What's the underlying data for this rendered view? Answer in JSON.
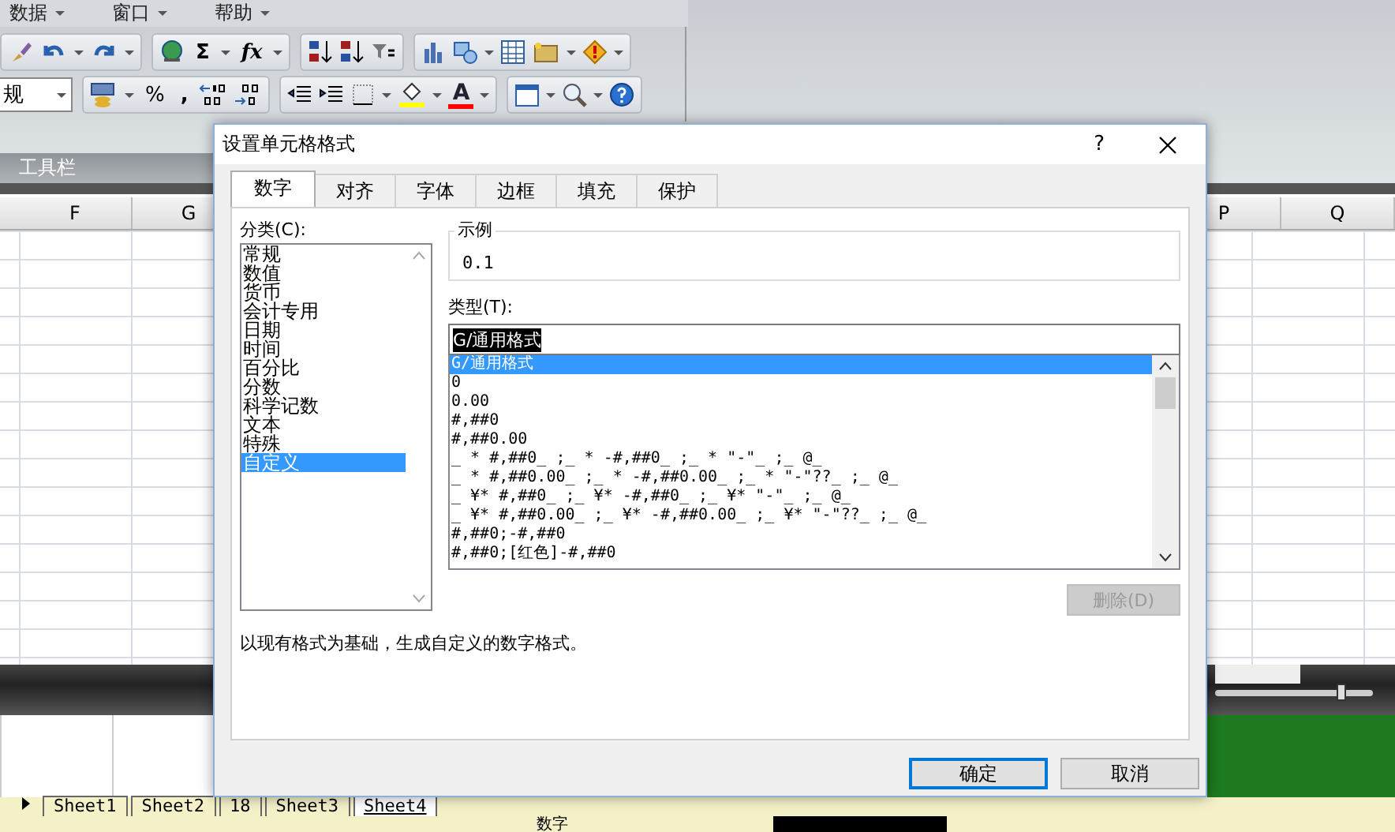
{
  "menu": [
    {
      "label": "数据"
    },
    {
      "label": "窗口"
    },
    {
      "label": "帮助"
    }
  ],
  "toolbar": {
    "sigma": "Σ",
    "fx": "fx",
    "number_format": "规",
    "percent": "%",
    "comma": ",",
    "font_color_letter": "A"
  },
  "zoom_slider": {
    "level": 0.8
  },
  "toolbar_label": "工具栏",
  "column_headers": [
    "F",
    "G",
    "P",
    "Q"
  ],
  "dialog": {
    "title": "设置单元格格式",
    "help": "?",
    "tabs": [
      {
        "label": "数字",
        "selected": true
      },
      {
        "label": "对齐",
        "selected": false
      },
      {
        "label": "字体",
        "selected": false
      },
      {
        "label": "边框",
        "selected": false
      },
      {
        "label": "填充",
        "selected": false
      },
      {
        "label": "保护",
        "selected": false
      }
    ],
    "category_label": "分类(C):",
    "categories": [
      {
        "label": "常规",
        "selected": false
      },
      {
        "label": "数值",
        "selected": false
      },
      {
        "label": "货币",
        "selected": false
      },
      {
        "label": "会计专用",
        "selected": false
      },
      {
        "label": "日期",
        "selected": false
      },
      {
        "label": "时间",
        "selected": false
      },
      {
        "label": "百分比",
        "selected": false
      },
      {
        "label": "分数",
        "selected": false
      },
      {
        "label": "科学记数",
        "selected": false
      },
      {
        "label": "文本",
        "selected": false
      },
      {
        "label": "特殊",
        "selected": false
      },
      {
        "label": "自定义",
        "selected": true
      }
    ],
    "sample_label": "示例",
    "sample_value": "0.1",
    "type_label": "类型(T):",
    "type_value": "G/通用格式",
    "formats": [
      {
        "label": "G/通用格式",
        "selected": true
      },
      {
        "label": "0",
        "selected": false
      },
      {
        "label": "0.00",
        "selected": false
      },
      {
        "label": "#,##0",
        "selected": false
      },
      {
        "label": "#,##0.00",
        "selected": false
      },
      {
        "label": "_ * #,##0_ ;_ * -#,##0_ ;_ * \"-\"_ ;_ @_",
        "selected": false
      },
      {
        "label": "_ * #,##0.00_ ;_ * -#,##0.00_ ;_ * \"-\"??_ ;_ @_",
        "selected": false
      },
      {
        "label": "_ ¥* #,##0_ ;_ ¥* -#,##0_ ;_ ¥* \"-\"_ ;_ @_",
        "selected": false
      },
      {
        "label": "_ ¥* #,##0.00_ ;_ ¥* -#,##0.00_ ;_ ¥* \"-\"??_ ;_ @_",
        "selected": false
      },
      {
        "label": "#,##0;-#,##0",
        "selected": false
      },
      {
        "label": "#,##0;[红色]-#,##0",
        "selected": false
      }
    ],
    "delete_button": {
      "label": "删除(D)",
      "disabled": true
    },
    "description": "以现有格式为基础，生成自定义的数字格式。",
    "ok": "确定",
    "cancel": "取消"
  },
  "sheet_tabs": [
    {
      "label": "Sheet1",
      "selected": false
    },
    {
      "label": "Sheet2",
      "selected": false
    },
    {
      "label": "18",
      "selected": false
    },
    {
      "label": "Sheet3",
      "selected": false
    },
    {
      "label": "Sheet4",
      "selected": true
    }
  ],
  "status_bar": {
    "mode": "数字"
  }
}
